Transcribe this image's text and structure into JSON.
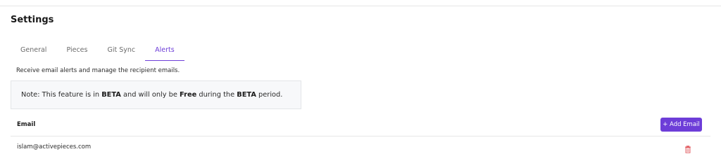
{
  "page": {
    "title": "Settings"
  },
  "tabs": [
    {
      "label": "General",
      "active": false
    },
    {
      "label": "Pieces",
      "active": false
    },
    {
      "label": "Git Sync",
      "active": false
    },
    {
      "label": "Alerts",
      "active": true
    }
  ],
  "alerts": {
    "description": "Receive email alerts and manage the recipient emails.",
    "note": {
      "part1": "Note: This feature is in ",
      "bold1": "BETA",
      "part2": " and will only be ",
      "bold2": "Free",
      "part3": " during the ",
      "bold3": "BETA",
      "part4": " period."
    },
    "table": {
      "column_header": "Email",
      "add_button_label": "+ Add Email",
      "rows": [
        {
          "email": "islam@activepieces.com",
          "action_icon": "trash-icon"
        }
      ]
    }
  },
  "colors": {
    "accent": "#6d3dd8",
    "delete": "#e0565b"
  }
}
